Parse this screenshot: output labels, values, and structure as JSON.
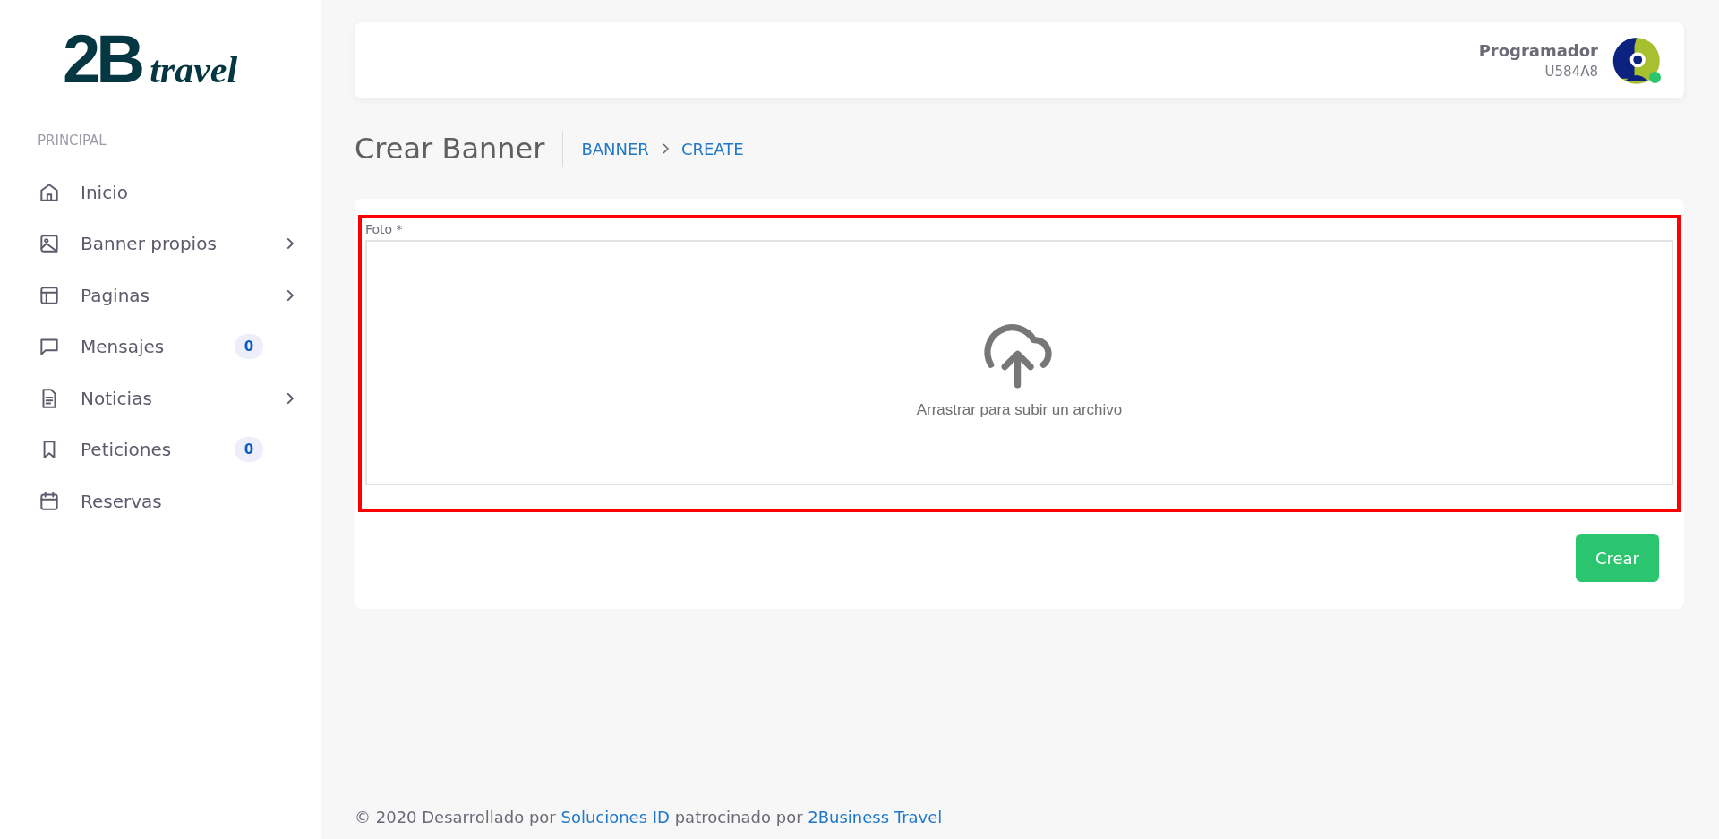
{
  "logo": {
    "mark": "2B",
    "word": "travel"
  },
  "sidebar": {
    "section": "PRINCIPAL",
    "items": [
      {
        "label": "Inicio",
        "submenu": false
      },
      {
        "label": "Banner propios",
        "submenu": true
      },
      {
        "label": "Paginas",
        "submenu": true
      },
      {
        "label": "Mensajes",
        "submenu": false,
        "badge": "0"
      },
      {
        "label": "Noticias",
        "submenu": true
      },
      {
        "label": "Peticiones",
        "submenu": false,
        "badge": "0"
      },
      {
        "label": "Reservas",
        "submenu": false
      }
    ]
  },
  "user": {
    "name": "Programador",
    "code": "U584A8",
    "online": true
  },
  "page": {
    "title": "Crear Banner",
    "breadcrumb": [
      "BANNER",
      "CREATE"
    ]
  },
  "form": {
    "field_label": "Foto *",
    "dropzone_text": "Arrastrar para subir un archivo",
    "highlighted": true,
    "submit": "Crear"
  },
  "footer": {
    "prefix": "© 2020 Desarrollado por",
    "link1": "Soluciones ID",
    "middle": "patrocinado por",
    "link2": "2Business Travel"
  }
}
